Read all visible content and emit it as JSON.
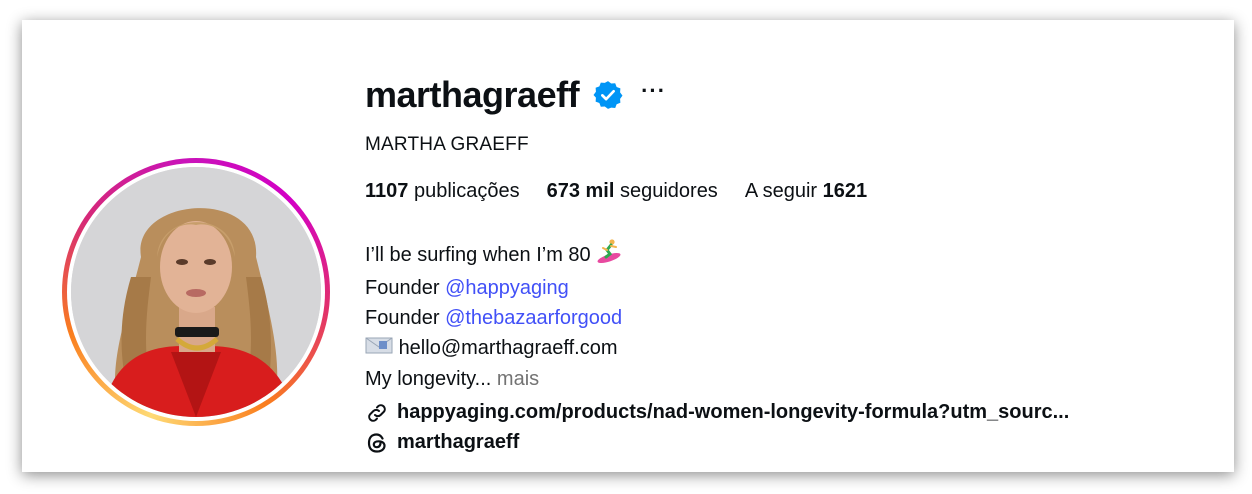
{
  "profile": {
    "username": "marthagraeff",
    "full_name": "MARTHA GRAEFF",
    "verified": true,
    "more_label": "···"
  },
  "stats": {
    "posts_count": "1107",
    "posts_label": "publicações",
    "followers_count": "673 mil",
    "followers_label": "seguidores",
    "following_label": "A seguir",
    "following_count": "1621"
  },
  "bio": {
    "line1": "I’ll be surfing when I’m 80",
    "line2_prefix": "Founder",
    "line2_mention": "@happyaging",
    "line3_prefix": "Founder",
    "line3_mention": "@thebazaarforgood",
    "line4_email": "hello@marthagraeff.com",
    "line5_text": "My longevity...",
    "line5_more": "mais"
  },
  "link": {
    "text": "happyaging.com/products/nad-women-longevity-formula?utm_sourc..."
  },
  "threads": {
    "handle": "marthagraeff"
  },
  "icons": {
    "verified": "verified-badge-icon",
    "more": "more-options-icon",
    "surfer": "surfer-emoji-icon",
    "envelope": "envelope-emoji-icon",
    "link": "link-icon",
    "threads": "threads-icon"
  },
  "colors": {
    "mention": "#4150f7",
    "verified": "#0095f6",
    "muted": "#737373",
    "text": "#0c1014"
  }
}
